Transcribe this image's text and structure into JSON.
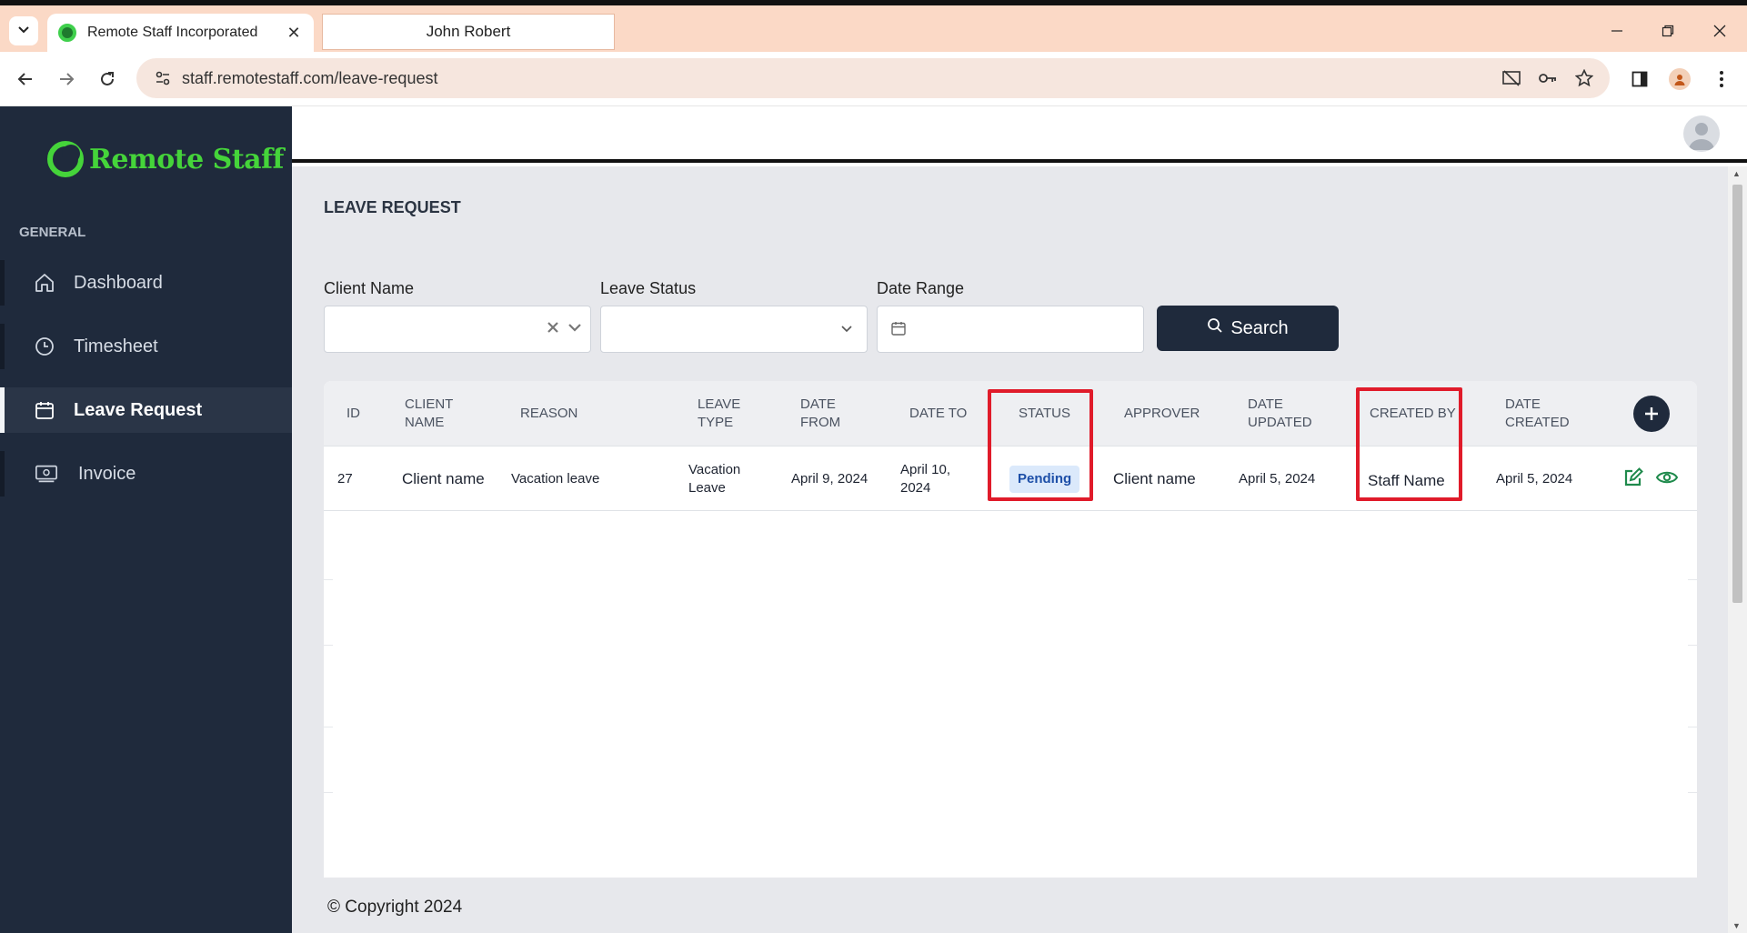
{
  "browser": {
    "tabs": [
      {
        "title": "Remote Staff Incorporated",
        "active": true
      },
      {
        "title": "John Robert",
        "active": false
      }
    ],
    "url": "staff.remotestaff.com/leave-request",
    "icons": [
      "back-icon",
      "forward-icon",
      "reload-icon",
      "site-info-icon",
      "cast-off-icon",
      "key-icon",
      "star-icon",
      "side-panel-icon",
      "profile-icon",
      "more-icon"
    ]
  },
  "sidebar": {
    "brand": "Remote Staff",
    "section": "GENERAL",
    "items": [
      {
        "label": "Dashboard",
        "icon": "home-icon",
        "active": false
      },
      {
        "label": "Timesheet",
        "icon": "clock-icon",
        "active": false
      },
      {
        "label": "Leave Request",
        "icon": "calendar-icon",
        "active": true
      },
      {
        "label": "Invoice",
        "icon": "invoice-icon",
        "active": false
      }
    ]
  },
  "page": {
    "title": "LEAVE REQUEST",
    "filters": {
      "client_name_label": "Client Name",
      "client_name_value": "",
      "leave_status_label": "Leave Status",
      "leave_status_value": "",
      "date_range_label": "Date Range",
      "date_range_value": "",
      "search_label": "Search"
    },
    "table": {
      "headers": {
        "id": "ID",
        "client_name": "CLIENT NAME",
        "reason": "REASON",
        "leave_type": "LEAVE TYPE",
        "date_from": "DATE FROM",
        "date_to": "DATE TO",
        "status": "STATUS",
        "approver": "APPROVER",
        "date_updated": "DATE UPDATED",
        "created_by": "CREATED BY",
        "date_created": "DATE CREATED"
      },
      "rows": [
        {
          "id": "27",
          "client_name": "Client name",
          "reason": "Vacation leave",
          "leave_type": "Vacation Leave",
          "date_from": "April 9, 2024",
          "date_to": "April 10, 2024",
          "status": "Pending",
          "approver": "Client name",
          "date_updated": "April 5, 2024",
          "created_by": "Staff Name",
          "date_created": "April 5, 2024"
        }
      ]
    },
    "footer": "© Copyright 2024"
  },
  "colors": {
    "sidebar_bg": "#1f2a3c",
    "brand_green": "#45d43a",
    "highlight_red": "#e01b2a",
    "badge_bg": "#dbe9fb",
    "badge_text": "#1d4fa8",
    "action_green": "#1f8a4c"
  }
}
